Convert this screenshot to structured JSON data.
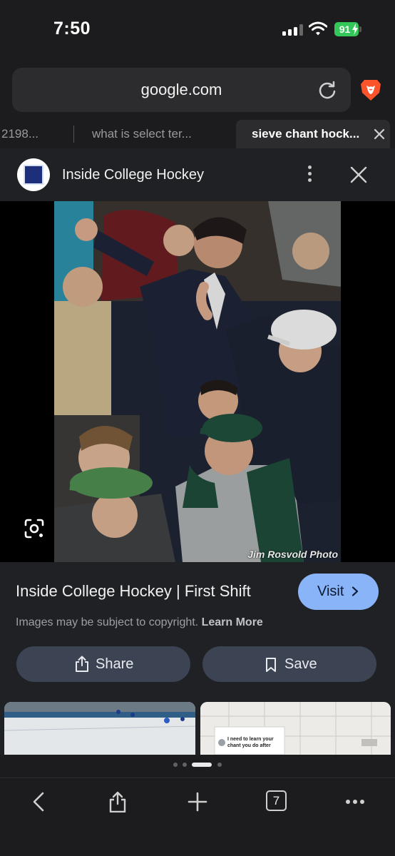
{
  "status_bar": {
    "time": "7:50",
    "battery": "91"
  },
  "browser": {
    "url": "google.com",
    "tabs": [
      {
        "label": "2198..."
      },
      {
        "label": "what is select ter..."
      },
      {
        "label": "sieve chant hock..."
      }
    ],
    "open_tab_count": "7"
  },
  "viewer": {
    "source_name": "Inside College Hockey",
    "photo_credit": "Jim Rosvold Photo"
  },
  "result": {
    "title": "Inside College Hockey | First Shift",
    "visit_label": "Visit",
    "copyright_text": "Images may be subject to copyright.",
    "learn_more": "Learn More",
    "share_label": "Share",
    "save_label": "Save",
    "thumbnail_text": "I need to learn your chant you do after",
    "pager": {
      "pages": 4,
      "active": 3
    }
  },
  "colors": {
    "accent": "#8ab4f8",
    "button_bg": "#3c4454",
    "battery": "#33c75a",
    "brave": "#fb542b"
  },
  "icons": [
    "signal-icon",
    "wifi-icon",
    "battery-icon",
    "reload-icon",
    "brave-lion-icon",
    "close-icon",
    "more-vert-icon",
    "google-lens-icon",
    "chevron-right-icon",
    "share-icon",
    "bookmark-icon",
    "back-icon",
    "add-icon",
    "more-horiz-icon"
  ]
}
